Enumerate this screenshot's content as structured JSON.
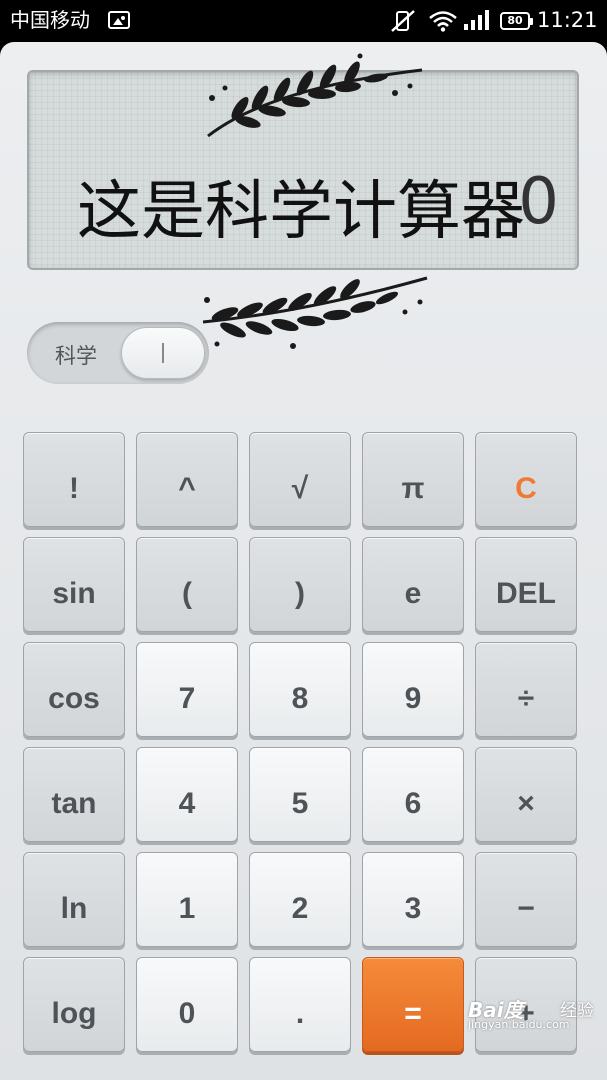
{
  "status_bar": {
    "carrier": "中国移动",
    "battery": "80",
    "time": "11:21"
  },
  "display": {
    "value": "0",
    "caption": "这是科学计算器"
  },
  "mode_toggle": {
    "label": "科学"
  },
  "keypad": {
    "keys": [
      {
        "label": "!",
        "kind": "func"
      },
      {
        "label": "^",
        "kind": "func"
      },
      {
        "label": "√",
        "kind": "func"
      },
      {
        "label": "π",
        "kind": "func"
      },
      {
        "label": "C",
        "kind": "clear"
      },
      {
        "label": "sin",
        "kind": "func"
      },
      {
        "label": "(",
        "kind": "func"
      },
      {
        "label": ")",
        "kind": "func"
      },
      {
        "label": "e",
        "kind": "func"
      },
      {
        "label": "DEL",
        "kind": "func"
      },
      {
        "label": "cos",
        "kind": "func"
      },
      {
        "label": "7",
        "kind": "num"
      },
      {
        "label": "8",
        "kind": "num"
      },
      {
        "label": "9",
        "kind": "num"
      },
      {
        "label": "÷",
        "kind": "func"
      },
      {
        "label": "tan",
        "kind": "func"
      },
      {
        "label": "4",
        "kind": "num"
      },
      {
        "label": "5",
        "kind": "num"
      },
      {
        "label": "6",
        "kind": "num"
      },
      {
        "label": "×",
        "kind": "func"
      },
      {
        "label": "ln",
        "kind": "func"
      },
      {
        "label": "1",
        "kind": "num"
      },
      {
        "label": "2",
        "kind": "num"
      },
      {
        "label": "3",
        "kind": "num"
      },
      {
        "label": "−",
        "kind": "func"
      },
      {
        "label": "log",
        "kind": "func"
      },
      {
        "label": "0",
        "kind": "num"
      },
      {
        "label": ".",
        "kind": "num"
      },
      {
        "label": "=",
        "kind": "equals"
      },
      {
        "label": "+",
        "kind": "func"
      }
    ]
  },
  "watermark": {
    "brand": "Bai度",
    "sub": "经验",
    "url": "jingyan.baidu.com"
  },
  "colors": {
    "accent_orange": "#ef7b2f",
    "clear_text": "#ee7a33",
    "key_text": "#4e5358",
    "display_bg": "#d6dcdc"
  }
}
